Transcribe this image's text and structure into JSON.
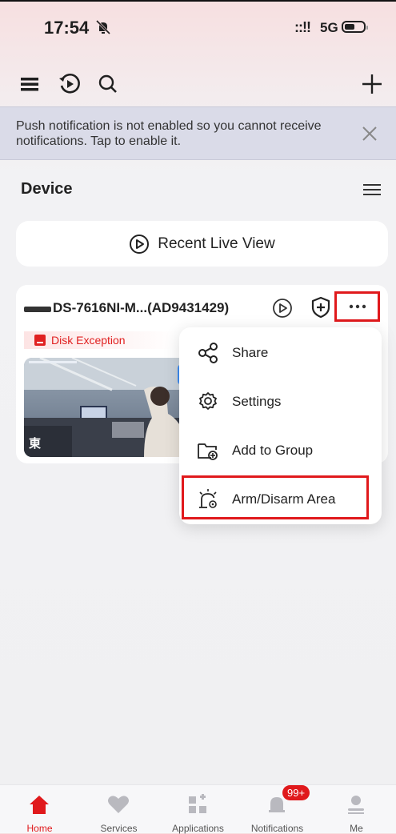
{
  "status_bar": {
    "time": "17:54",
    "network": "5G"
  },
  "notice": {
    "text": "Push notification is not enabled so you cannot receive notifications. Tap to enable it."
  },
  "device_section": {
    "title": "Device"
  },
  "recent_live_view": {
    "label": "Recent Live View"
  },
  "device_card": {
    "name": "DS-7616NI-M...(AD9431429)",
    "exception_label": "Disk Exception",
    "thumbnail_overlay_text": "東"
  },
  "popup_menu": {
    "items": [
      {
        "label": "Share",
        "icon": "share-icon"
      },
      {
        "label": "Settings",
        "icon": "gear-icon"
      },
      {
        "label": "Add to Group",
        "icon": "folder-add-icon"
      },
      {
        "label": "Arm/Disarm Area",
        "icon": "alarm-area-icon"
      }
    ]
  },
  "bottom_nav": {
    "items": [
      {
        "label": "Home",
        "icon": "home-icon",
        "active": true
      },
      {
        "label": "Services",
        "icon": "heart-icon"
      },
      {
        "label": "Applications",
        "icon": "apps-icon"
      },
      {
        "label": "Notifications",
        "icon": "bell-icon",
        "badge": "99+"
      },
      {
        "label": "Me",
        "icon": "person-icon"
      }
    ]
  },
  "colors": {
    "accent": "#e0191c",
    "highlight_box": "#e0191c"
  }
}
